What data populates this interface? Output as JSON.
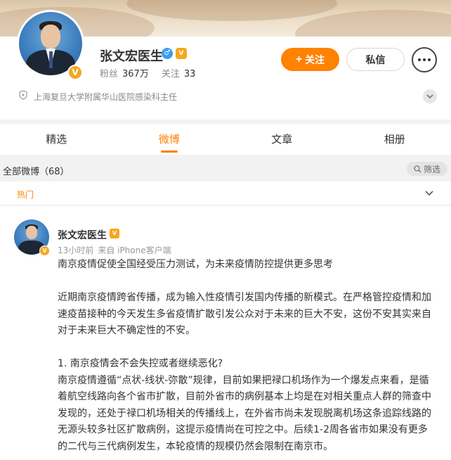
{
  "profile": {
    "name": "张文宏医生",
    "fans_label": "粉丝",
    "fans_count": "367万",
    "following_label": "关注",
    "following_count": "33",
    "description": "上海复旦大学附属华山医院感染科主任",
    "follow_button": "关注",
    "message_button": "私信",
    "accent_color": "#ff8200"
  },
  "tabs": [
    {
      "label": "精选",
      "active": false
    },
    {
      "label": "微博",
      "active": true
    },
    {
      "label": "文章",
      "active": false
    },
    {
      "label": "相册",
      "active": false
    }
  ],
  "filter": {
    "label": "全部微博（68）",
    "button": "筛选"
  },
  "hot": {
    "label": "热门"
  },
  "post": {
    "author": "张文宏医生",
    "time": "13小时前",
    "source": "来自 iPhone客户端",
    "headline": "南京疫情促使全国经受压力测试，为未来疫情防控提供更多思考",
    "paragraph1": "近期南京疫情跨省传播，成为输入性疫情引发国内传播的新模式。在严格管控疫情和加速疫苗接种的今天发生多省疫情扩散引发公众对于未来的巨大不安，这份不安其实来自对于未来巨大不确定性的不安。",
    "question": "1. 南京疫情会不会失控或者继续恶化?",
    "paragraph2": "南京疫情遵循“点状-线状-弥散”规律，目前如果把禄口机场作为一个爆发点来看，是循着航空线路向各个省市扩散，目前外省市的病例基本上均是在对相关重点人群的筛查中发现的，还处于禄口机场相关的传播线上，在外省市尚未发现脱离机场这条追踪线路的无源头较多社区扩散病例，这提示疫情尚在可控之中。后续1-2周各省市如果没有更多的二代与三代病例发生，本轮疫情的规模仍然会限制在南京市。"
  }
}
